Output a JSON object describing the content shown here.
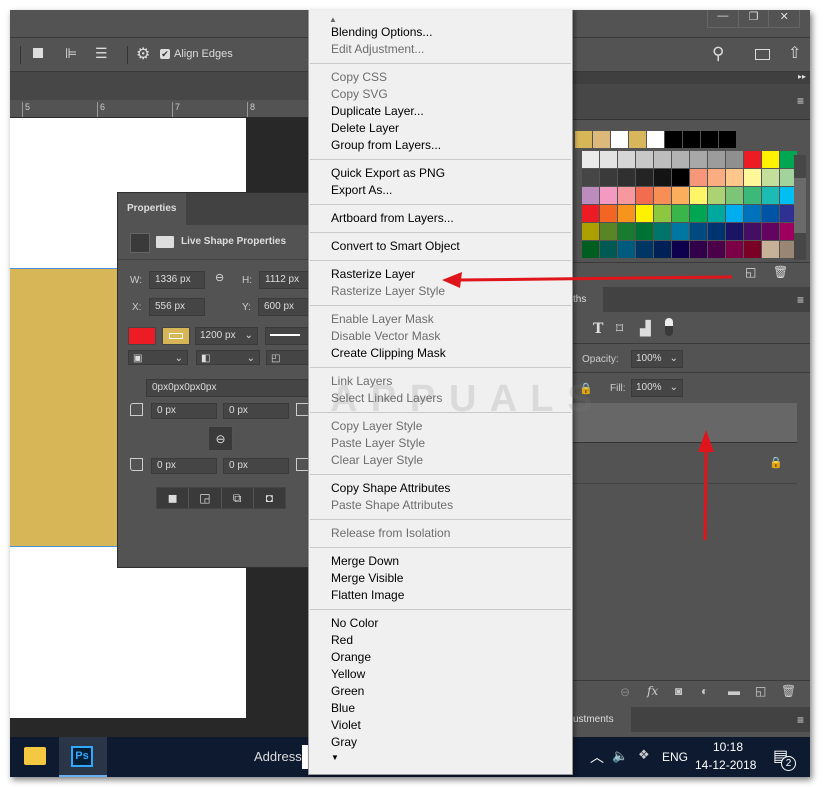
{
  "window_controls": {
    "minimize": "—",
    "restore": "❐",
    "close": "✕"
  },
  "options_bar": {
    "align_edges_label": "Align Edges",
    "align_edges_checked": true
  },
  "ruler": {
    "ticks": [
      "5",
      "6",
      "7",
      "8"
    ]
  },
  "properties": {
    "tab": "Properties",
    "header": "Live Shape Properties",
    "w_label": "W:",
    "w": "1336 px",
    "h_label": "H:",
    "h": "1112 px",
    "x_label": "X:",
    "x": "556 px",
    "y_label": "Y:",
    "y": "600 px",
    "fill_color": "#ed1c24",
    "stroke_color": "#d6b656",
    "stroke_width": "1200 px",
    "corners_all": "0px0px0px0px",
    "corner_tl": "0 px",
    "corner_tr": "0 px",
    "corner_bl": "0 px",
    "corner_br": "0 px"
  },
  "context_menu": {
    "groups": [
      [
        {
          "label": "Blending Options...",
          "enabled": true
        },
        {
          "label": "Edit Adjustment...",
          "enabled": false
        }
      ],
      [
        {
          "label": "Copy CSS",
          "enabled": false
        },
        {
          "label": "Copy SVG",
          "enabled": false
        },
        {
          "label": "Duplicate Layer...",
          "enabled": true
        },
        {
          "label": "Delete Layer",
          "enabled": true
        },
        {
          "label": "Group from Layers...",
          "enabled": true
        }
      ],
      [
        {
          "label": "Quick Export as PNG",
          "enabled": true
        },
        {
          "label": "Export As...",
          "enabled": true
        }
      ],
      [
        {
          "label": "Artboard from Layers...",
          "enabled": true
        }
      ],
      [
        {
          "label": "Convert to Smart Object",
          "enabled": true
        }
      ],
      [
        {
          "label": "Rasterize Layer",
          "enabled": true
        },
        {
          "label": "Rasterize Layer Style",
          "enabled": false
        }
      ],
      [
        {
          "label": "Enable Layer Mask",
          "enabled": false
        },
        {
          "label": "Disable Vector Mask",
          "enabled": false
        },
        {
          "label": "Create Clipping Mask",
          "enabled": true
        }
      ],
      [
        {
          "label": "Link Layers",
          "enabled": false
        },
        {
          "label": "Select Linked Layers",
          "enabled": false
        }
      ],
      [
        {
          "label": "Copy Layer Style",
          "enabled": false
        },
        {
          "label": "Paste Layer Style",
          "enabled": false
        },
        {
          "label": "Clear Layer Style",
          "enabled": false
        }
      ],
      [
        {
          "label": "Copy Shape Attributes",
          "enabled": true
        },
        {
          "label": "Paste Shape Attributes",
          "enabled": false
        }
      ],
      [
        {
          "label": "Release from Isolation",
          "enabled": false
        }
      ],
      [
        {
          "label": "Merge Down",
          "enabled": true
        },
        {
          "label": "Merge Visible",
          "enabled": true
        },
        {
          "label": "Flatten Image",
          "enabled": true
        }
      ],
      [
        {
          "label": "No Color",
          "enabled": true
        },
        {
          "label": "Red",
          "enabled": true
        },
        {
          "label": "Orange",
          "enabled": true
        },
        {
          "label": "Yellow",
          "enabled": true
        },
        {
          "label": "Green",
          "enabled": true
        },
        {
          "label": "Blue",
          "enabled": true
        },
        {
          "label": "Violet",
          "enabled": true
        },
        {
          "label": "Gray",
          "enabled": true
        }
      ]
    ]
  },
  "watermark": "APPUALS",
  "swatches": {
    "recent": [
      "#d6b656",
      "#dcb97a",
      "#ffffff",
      "#d8b75c",
      "#ffffff",
      "#000000",
      "#000000",
      "#000000",
      "#000000"
    ],
    "grid": [
      [
        "#ebebeb",
        "#e3e3e3",
        "#d6d6d6",
        "#c8c8c8",
        "#bdbdbd",
        "#b2b2b2",
        "#a8a8a8",
        "#9c9c9c",
        "#8f8f8f",
        "#ed1c24",
        "#fff200",
        "#00a651"
      ],
      [
        "#464646",
        "#3a3a3a",
        "#303030",
        "#242424",
        "#141414",
        "#000000",
        "#f7977a",
        "#f9ad81",
        "#fdc68a",
        "#fff79a",
        "#c4df9b",
        "#a3d39c"
      ],
      [
        "#bd8cbf",
        "#f49ac2",
        "#f6989d",
        "#f26c4f",
        "#f68e56",
        "#fbaf5d",
        "#fff568",
        "#acd373",
        "#7cc576",
        "#3cb878",
        "#1cbbb4",
        "#00bff3"
      ],
      [
        "#ed1c24",
        "#f26522",
        "#f7941d",
        "#fff200",
        "#8dc63f",
        "#39b54a",
        "#00a651",
        "#00a99d",
        "#00aeef",
        "#0072bc",
        "#0054a6",
        "#2e3192"
      ],
      [
        "#aba000",
        "#598527",
        "#197b30",
        "#007236",
        "#00746b",
        "#0076a3",
        "#004a80",
        "#003471",
        "#1b1464",
        "#440e62",
        "#630460",
        "#9e005d"
      ],
      [
        "#005e20",
        "#005952",
        "#005b7f",
        "#003663",
        "#002157",
        "#0d004c",
        "#32004b",
        "#4b0049",
        "#7b0046",
        "#7a0026",
        "#c7b299",
        "#998675"
      ]
    ]
  },
  "layers": {
    "tab": "ths",
    "opacity_label": "Opacity:",
    "opacity": "100%",
    "fill_label": "Fill:",
    "fill": "100%"
  },
  "adjustments_tab": "ustments",
  "taskbar": {
    "ps_label": "Ps",
    "address_label": "Address",
    "lang": "ENG",
    "time": "10:18",
    "date": "14-12-2018",
    "notifications": "2"
  },
  "annotation_color": "#e0151b"
}
